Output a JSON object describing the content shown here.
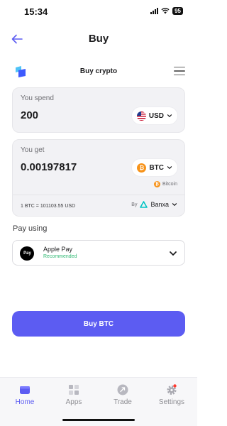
{
  "status_bar": {
    "time": "15:34",
    "battery": "95"
  },
  "header": {
    "title": "Buy"
  },
  "widget": {
    "title": "Buy crypto"
  },
  "spend": {
    "label": "You spend",
    "amount": "200",
    "currency": "USD"
  },
  "get": {
    "label": "You get",
    "amount": "0.00197817",
    "currency": "BTC",
    "currency_name": "Bitcoin",
    "currency_symbol": "₿"
  },
  "rate": {
    "text": "1 BTC = 101103.55 USD",
    "by_label": "By",
    "provider": "Banxa"
  },
  "payment": {
    "section_label": "Pay using",
    "method": "Apple Pay",
    "method_icon_text": "Pay",
    "method_sub": "Recommended"
  },
  "buy_button": {
    "label": "Buy BTC"
  },
  "tabs": [
    {
      "label": "Home",
      "icon": "wallet-icon",
      "active": true
    },
    {
      "label": "Apps",
      "icon": "grid-icon",
      "active": false
    },
    {
      "label": "Trade",
      "icon": "swap-icon",
      "active": false
    },
    {
      "label": "Settings",
      "icon": "gear-icon",
      "active": false
    }
  ],
  "colors": {
    "accent": "#5c5cf2",
    "recommended": "#2eb872",
    "bitcoin": "#f7931a",
    "banxa": "#00c4c4",
    "notification": "#ff3b30"
  }
}
